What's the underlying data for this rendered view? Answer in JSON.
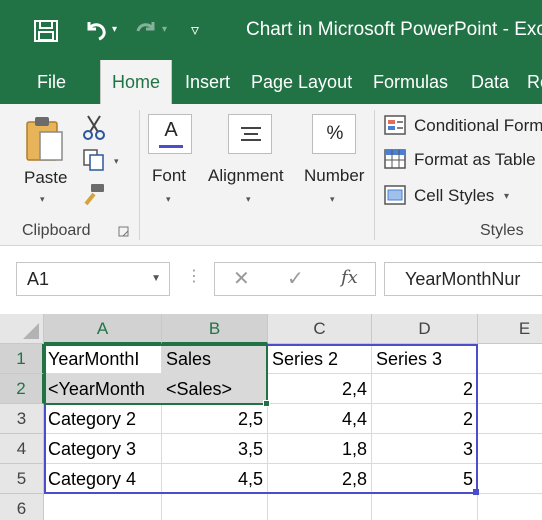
{
  "window": {
    "title": "Chart in Microsoft PowerPoint  -  Exce"
  },
  "tabs": [
    {
      "label": "File"
    },
    {
      "label": "Home"
    },
    {
      "label": "Insert"
    },
    {
      "label": "Page Layout"
    },
    {
      "label": "Formulas"
    },
    {
      "label": "Data"
    },
    {
      "label": "Re"
    }
  ],
  "ribbon": {
    "clipboard": {
      "paste_label": "Paste",
      "group_label": "Clipboard"
    },
    "font": {
      "label": "Font",
      "icon_letter": "A"
    },
    "alignment": {
      "label": "Alignment"
    },
    "number": {
      "label": "Number",
      "icon_symbol": "%"
    },
    "styles": {
      "conditional_formatting": "Conditional Form",
      "format_as_table": "Format as Table",
      "cell_styles": "Cell Styles",
      "group_label": "Styles"
    }
  },
  "formula_bar": {
    "name_box": "A1",
    "fx_label": "fx",
    "content": "YearMonthNur"
  },
  "grid": {
    "columns": [
      "A",
      "B",
      "C",
      "D",
      "E"
    ],
    "rows": [
      "1",
      "2",
      "3",
      "4",
      "5",
      "6"
    ],
    "cells": [
      [
        "YearMonthI",
        "Sales",
        "Series 2",
        "Series 3",
        ""
      ],
      [
        "<YearMonth",
        "<Sales>",
        "2,4",
        "2",
        ""
      ],
      [
        "Category 2",
        "2,5",
        "4,4",
        "2",
        ""
      ],
      [
        "Category 3",
        "3,5",
        "1,8",
        "3",
        ""
      ],
      [
        "Category 4",
        "4,5",
        "2,8",
        "5",
        ""
      ],
      [
        "",
        "",
        "",
        "",
        ""
      ]
    ]
  },
  "colors": {
    "brand_green": "#217346",
    "range_blue": "#4a4fc9"
  }
}
